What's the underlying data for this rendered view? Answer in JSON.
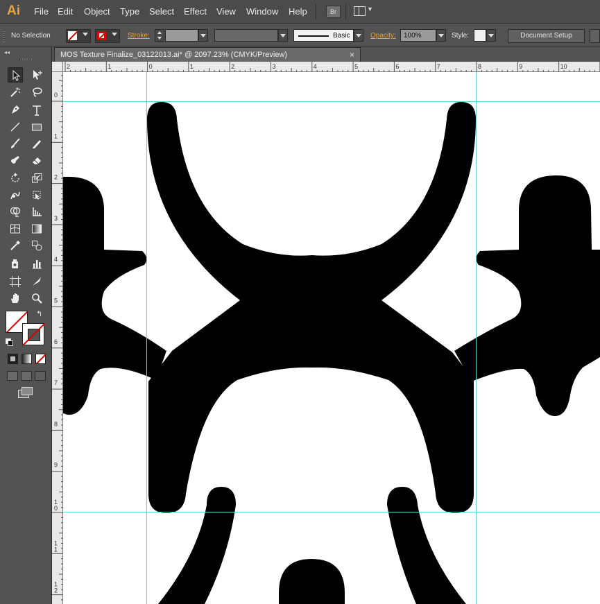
{
  "app": {
    "logo": "Ai"
  },
  "menu": {
    "items": [
      "File",
      "Edit",
      "Object",
      "Type",
      "Select",
      "Effect",
      "View",
      "Window",
      "Help"
    ],
    "bridge_label": "Br"
  },
  "control": {
    "selection": "No Selection",
    "stroke_label": "Stroke:",
    "brush_label": "Basic",
    "opacity_label": "Opacity:",
    "opacity_value": "100%",
    "style_label": "Style:",
    "document_setup": "Document Setup"
  },
  "document": {
    "tab_title": "MOS Texture Finalize_03122013.ai* @ 2097.23% (CMYK/Preview)",
    "close_glyph": "×"
  },
  "rulers": {
    "horizontal": [
      "2",
      "1",
      "0",
      "1",
      "2",
      "3",
      "4",
      "5",
      "6",
      "7",
      "8",
      "9",
      "10"
    ],
    "vertical": [
      "0",
      "1",
      "2",
      "3",
      "4",
      "5",
      "6",
      "7",
      "8",
      "9",
      "10",
      "11",
      "12"
    ]
  },
  "icons": {
    "tools": [
      "selection-tool-icon",
      "direct-selection-tool-icon",
      "magic-wand-tool-icon",
      "lasso-tool-icon",
      "pen-tool-icon",
      "type-tool-icon",
      "line-segment-tool-icon",
      "rectangle-tool-icon",
      "paintbrush-tool-icon",
      "pencil-tool-icon",
      "blob-brush-tool-icon",
      "eraser-tool-icon",
      "rotate-tool-icon",
      "scale-tool-icon",
      "warp-tool-icon",
      "free-transform-tool-icon",
      "shape-builder-tool-icon",
      "graph-tool-icon",
      "mesh-tool-icon",
      "gradient-tool-icon",
      "eyedropper-tool-icon",
      "blend-tool-icon",
      "symbol-sprayer-tool-icon",
      "column-graph-tool-icon",
      "artboard-tool-icon",
      "slice-tool-icon",
      "hand-tool-icon",
      "zoom-tool-icon"
    ]
  },
  "colors": {
    "accent": "#e8a33a",
    "guide": "#5ad8d8",
    "artwork": "#000000"
  }
}
